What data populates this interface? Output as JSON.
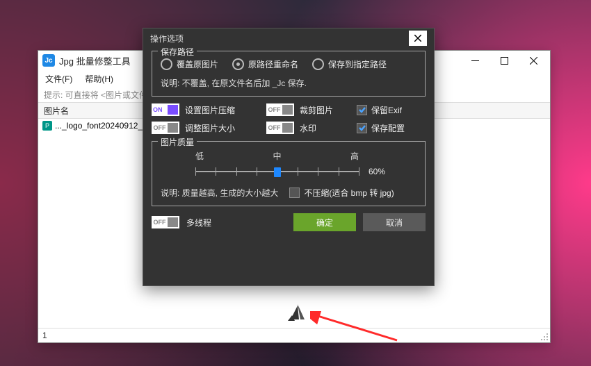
{
  "app": {
    "title": "Jpg 批量修整工具",
    "menu": {
      "file": "文件(F)",
      "help": "帮助(H)"
    },
    "hint": "提示: 可直接将 <图片或文件夹> ...",
    "column_header": "图片名",
    "files": [
      {
        "icon_badge": "P",
        "name": "..._logo_font20240912_..."
      }
    ],
    "status": "1"
  },
  "dialog": {
    "title": "操作选项",
    "groups": {
      "save": {
        "legend": "保存路径",
        "radios": [
          {
            "label": "覆盖原图片",
            "checked": false
          },
          {
            "label": "原路径重命名",
            "checked": true
          },
          {
            "label": "保存到指定路径",
            "checked": false
          }
        ],
        "desc": "说明: 不覆盖, 在原文件名后加 _Jc 保存."
      },
      "quality": {
        "legend": "图片质量",
        "marks": {
          "low": "低",
          "mid": "中",
          "high": "高"
        },
        "value_pct": 50,
        "readout": "60%",
        "desc": "说明: 质量越高, 生成的大小越大",
        "nocomp": "不压缩(适合 bmp 转 jpg)"
      }
    },
    "toggles": {
      "on": "ON",
      "off": "OFF",
      "compress": "设置图片压缩",
      "crop": "裁剪图片",
      "resize": "调整图片大小",
      "watermark": "水印",
      "keep_exif": "保留Exif",
      "save_cfg": "保存配置",
      "multithread": "多线程"
    },
    "buttons": {
      "ok": "确定",
      "cancel": "取消"
    }
  }
}
